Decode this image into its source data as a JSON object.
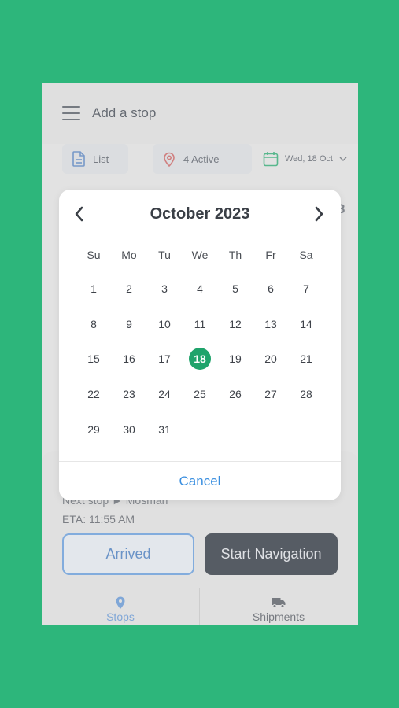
{
  "header": {
    "title": "Add a stop"
  },
  "chips": {
    "list_label": "List",
    "active_label": "4 Active",
    "date_label": "Wed, 18 Oct"
  },
  "background_digit": "3",
  "sheet": {
    "next_stop": "Next stop  ►  Mosman",
    "eta": "ETA: 11:55 AM",
    "arrived_label": "Arrived",
    "start_nav_label": "Start Navigation"
  },
  "bottom_nav": {
    "stops_label": "Stops",
    "shipments_label": "Shipments"
  },
  "calendar": {
    "month_title": "October 2023",
    "weekdays": [
      "Su",
      "Mo",
      "Tu",
      "We",
      "Th",
      "Fr",
      "Sa"
    ],
    "weeks": [
      [
        "1",
        "2",
        "3",
        "4",
        "5",
        "6",
        "7"
      ],
      [
        "8",
        "9",
        "10",
        "11",
        "12",
        "13",
        "14"
      ],
      [
        "15",
        "16",
        "17",
        "18",
        "19",
        "20",
        "21"
      ],
      [
        "22",
        "23",
        "24",
        "25",
        "26",
        "27",
        "28"
      ],
      [
        "29",
        "30",
        "31"
      ]
    ],
    "selected_day": "18",
    "cancel_label": "Cancel"
  },
  "colors": {
    "background": "#2db67b",
    "selected_day": "#1fa36b",
    "accent_blue": "#3a8fe0"
  }
}
